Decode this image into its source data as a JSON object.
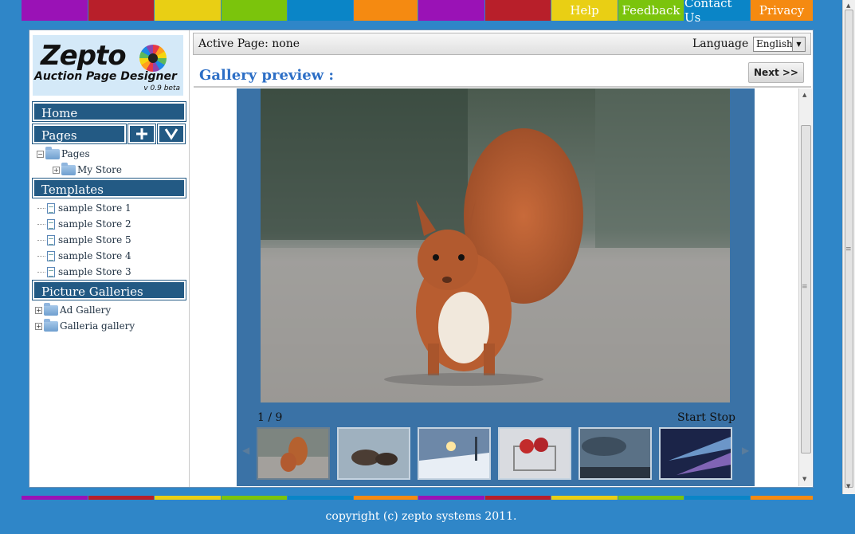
{
  "top_nav": {
    "colors": [
      "#9a12b6",
      "#b81f2a",
      "#e9cf14",
      "#7bc40c",
      "#0a85c7",
      "#f58a11",
      "#9a12b6",
      "#b81f2a",
      "#e9cf14",
      "#7bc40c",
      "#0a85c7",
      "#f58a11"
    ],
    "help": "Help",
    "feedback": "Feedback",
    "contact": "Contact Us",
    "privacy": "Privacy"
  },
  "logo": {
    "name": "Zepto",
    "subtitle": "Auction Page Designer",
    "version": "v 0.9 beta"
  },
  "sidebar": {
    "home": "Home",
    "pages": "Pages",
    "pages_tree": {
      "root": "Pages",
      "child": "My Store"
    },
    "templates": "Templates",
    "template_items": [
      "sample Store 1",
      "sample Store 2",
      "sample Store 5",
      "sample Store 4",
      "sample Store 3"
    ],
    "galleries": "Picture Galleries",
    "gallery_items": [
      "Ad Gallery",
      "Galleria gallery"
    ]
  },
  "header": {
    "active_page": "Active Page: none",
    "language_label": "Language :",
    "language_value": "English"
  },
  "gallery": {
    "title": "Gallery preview :",
    "next": "Next >>",
    "counter": "1 / 9",
    "start_stop": "Start Stop",
    "thumbnails": [
      "squirrel",
      "otters",
      "snowy-sunset",
      "apples-basket",
      "stormy-sky",
      "stage-lights"
    ]
  },
  "footer": "copyright (c) zepto systems 2011."
}
